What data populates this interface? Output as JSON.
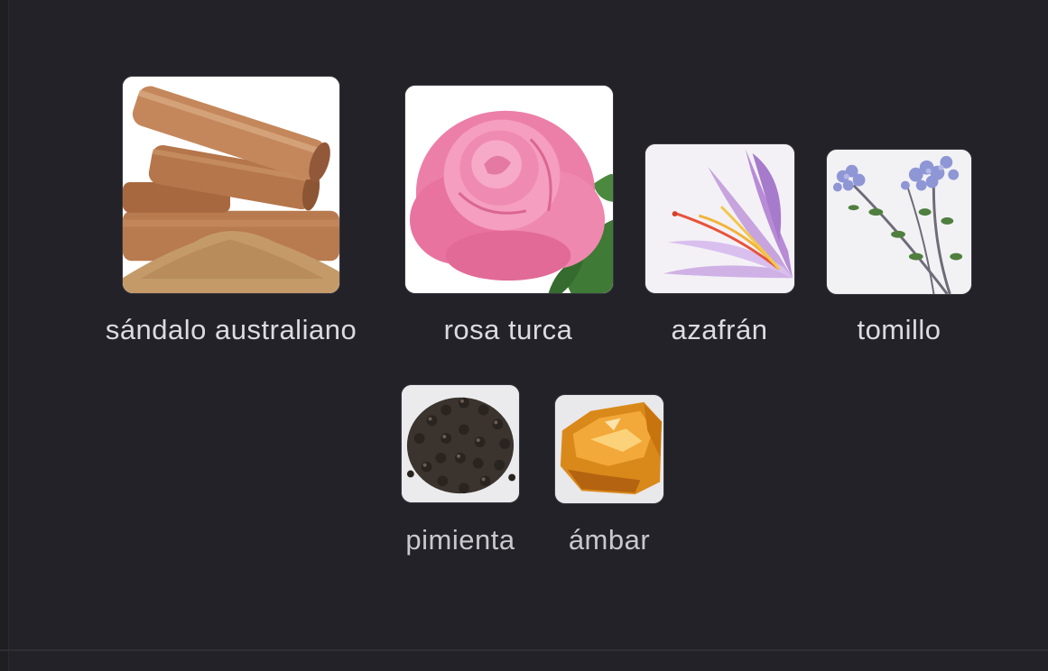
{
  "notes": [
    {
      "id": "sandalo",
      "label": "sándalo australiano",
      "icon": "sandalwood-image"
    },
    {
      "id": "rosa",
      "label": "rosa turca",
      "icon": "rose-image"
    },
    {
      "id": "azafran",
      "label": "azafrán",
      "icon": "saffron-flower-image"
    },
    {
      "id": "tomillo",
      "label": "tomillo",
      "icon": "thyme-image"
    },
    {
      "id": "pimienta",
      "label": "pimienta",
      "icon": "black-pepper-image"
    },
    {
      "id": "ambar",
      "label": "ámbar",
      "icon": "amber-resin-image"
    }
  ],
  "colors": {
    "background": "#232228",
    "label": "#dcdbe0"
  }
}
